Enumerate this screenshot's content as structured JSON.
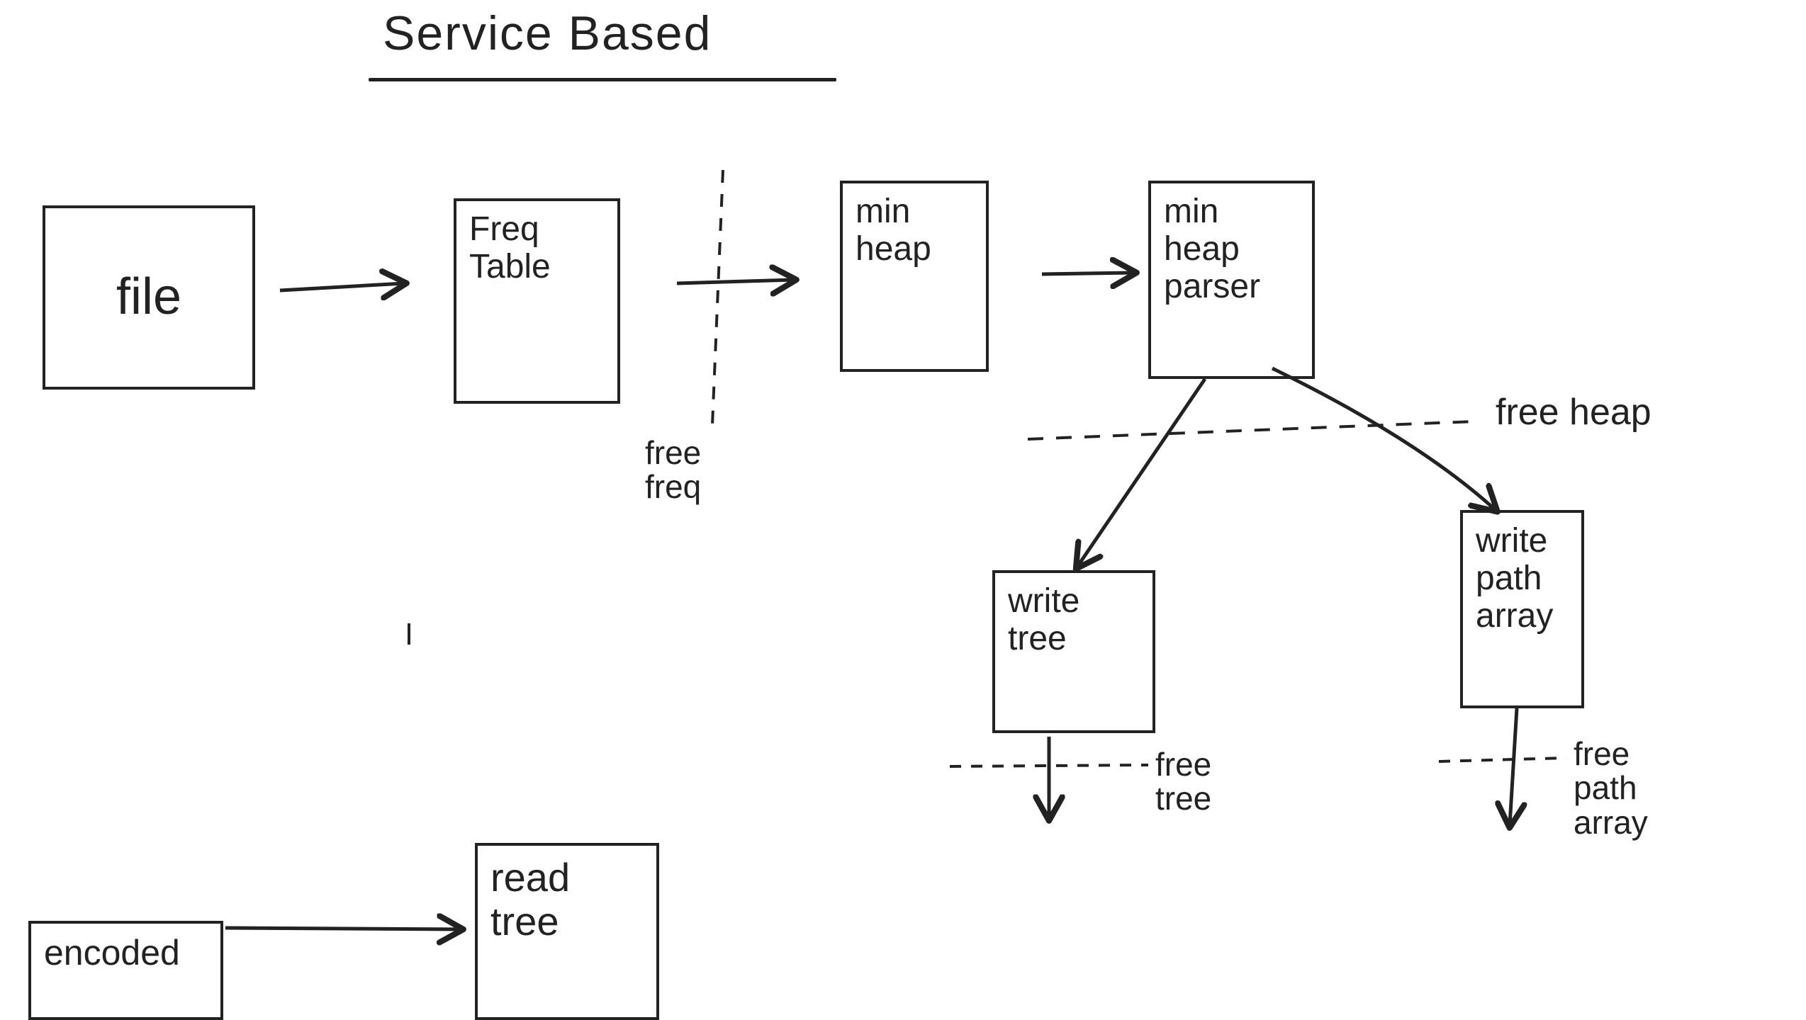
{
  "title": "Service Based",
  "boxes": {
    "file": "file",
    "freq_table": "Freq\nTable",
    "min_heap": "min\nheap",
    "min_heap_parser": "min\nheap\nparser",
    "write_tree": "write\ntree",
    "write_path_array": "write\npath\narray",
    "encoded": "encoded",
    "read_tree": "read\ntree"
  },
  "labels": {
    "free_freq": "free\nfreq",
    "free_heap": "free heap",
    "free_tree": "free\ntree",
    "free_path_array": "free\npath\narray"
  }
}
